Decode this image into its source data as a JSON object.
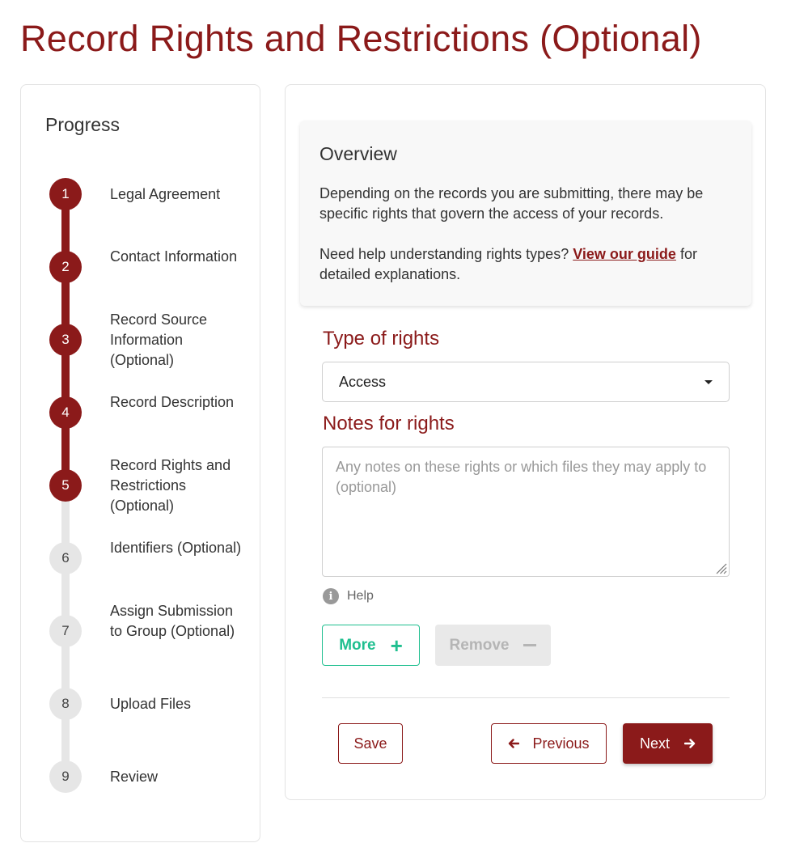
{
  "page": {
    "title": "Record Rights and Restrictions (Optional)"
  },
  "progress": {
    "title": "Progress",
    "steps": [
      {
        "number": "1",
        "label": "Legal Agreement",
        "status": "complete"
      },
      {
        "number": "2",
        "label": "Contact Information",
        "status": "complete"
      },
      {
        "number": "3",
        "label": "Record Source Information (Optional)",
        "status": "complete"
      },
      {
        "number": "4",
        "label": "Record Description",
        "status": "complete"
      },
      {
        "number": "5",
        "label": "Record Rights and Restrictions (Optional)",
        "status": "current"
      },
      {
        "number": "6",
        "label": "Identifiers (Optional)",
        "status": "pending"
      },
      {
        "number": "7",
        "label": "Assign Submission to Group (Optional)",
        "status": "pending"
      },
      {
        "number": "8",
        "label": "Upload Files",
        "status": "pending"
      },
      {
        "number": "9",
        "label": "Review",
        "status": "pending"
      }
    ]
  },
  "overview": {
    "title": "Overview",
    "paragraph1": "Depending on the records you are submitting, there may be specific rights that govern the access of your records.",
    "paragraph2_before": "Need help understanding rights types?",
    "paragraph2_link": "View our guide",
    "paragraph2_after": "for detailed explanations."
  },
  "form": {
    "type_label": "Type of rights",
    "type_value": "Access",
    "notes_label": "Notes for rights",
    "notes_value": "",
    "notes_placeholder": "Any notes on these rights or which files they may apply to (optional)",
    "help_label": "Help",
    "more_label": "More",
    "remove_label": "Remove"
  },
  "actions": {
    "save_label": "Save",
    "previous_label": "Previous",
    "next_label": "Next"
  },
  "colors": {
    "brand": "#8b1a1a",
    "accent_green": "#1fbf8f",
    "pending": "#e6e6e6"
  },
  "icons": {
    "more": "plus-icon",
    "remove": "minus-icon",
    "help": "info-icon",
    "previous": "arrow-left-icon",
    "next": "arrow-right-icon",
    "select": "caret-down-icon"
  }
}
